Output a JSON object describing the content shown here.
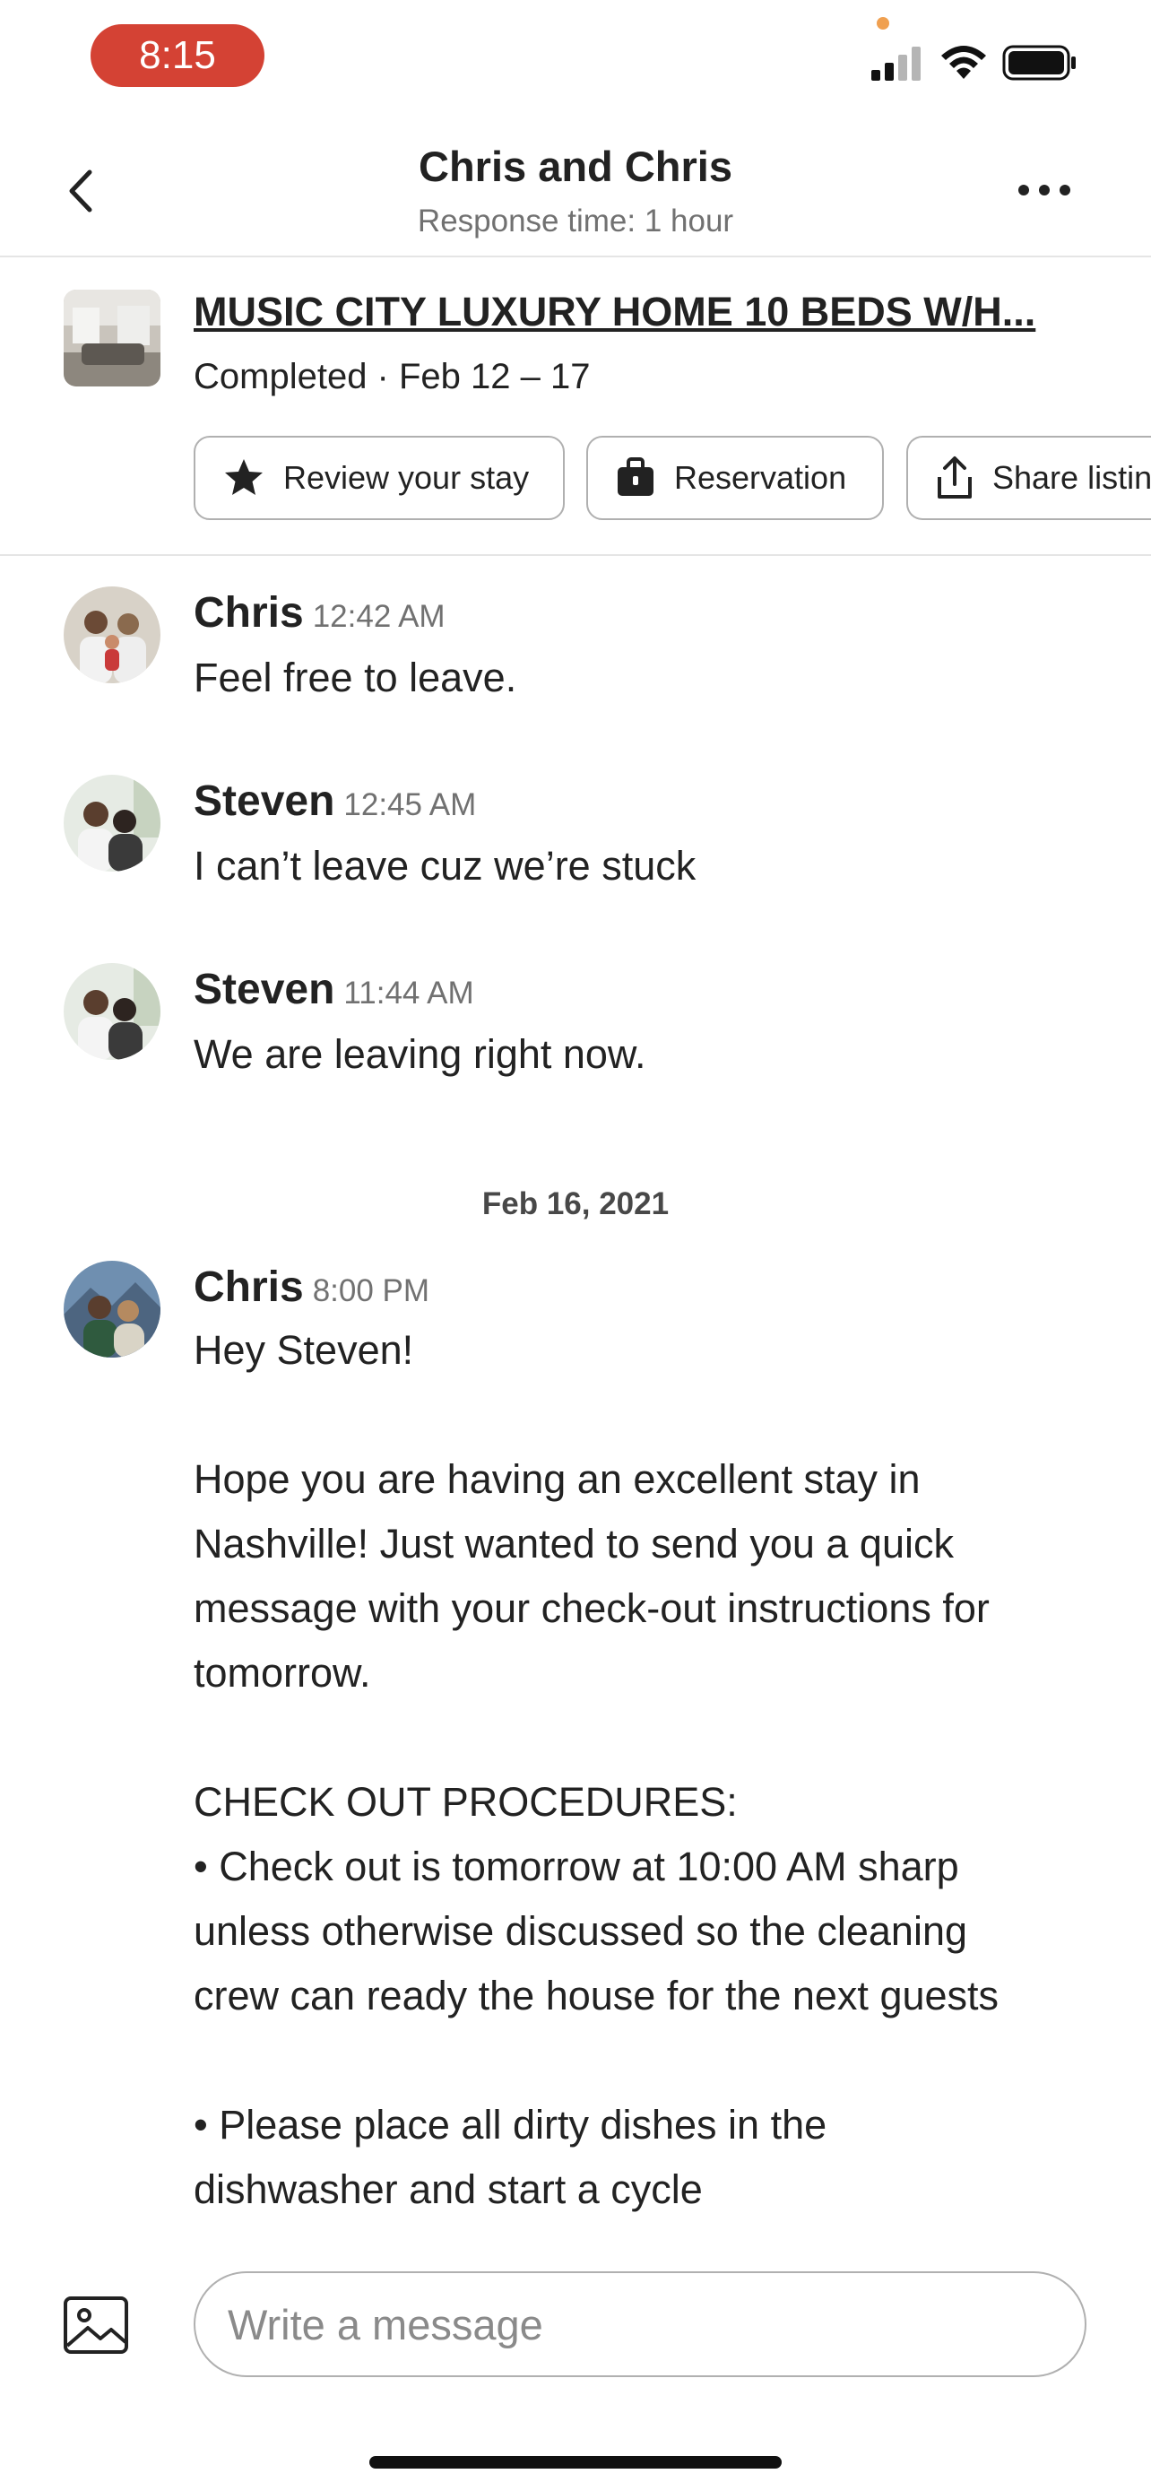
{
  "status_bar": {
    "time": "8:15"
  },
  "header": {
    "title": "Chris and Chris",
    "subtitle": "Response time: 1 hour"
  },
  "listing": {
    "title": "MUSIC CITY LUXURY HOME 10 BEDS W/H...",
    "status": "Completed · Feb 12 – 17",
    "actions": [
      {
        "label": "Review your stay",
        "icon": "star-icon"
      },
      {
        "label": "Reservation",
        "icon": "briefcase-icon"
      },
      {
        "label": "Share listin",
        "icon": "share-icon"
      }
    ]
  },
  "messages": [
    {
      "sender": "Chris",
      "time": "12:42 AM",
      "text": "Feel free to leave."
    },
    {
      "sender": "Steven",
      "time": "12:45 AM",
      "text": "I can’t leave cuz we’re stuck"
    },
    {
      "sender": "Steven",
      "time": "11:44 AM",
      "text": "We are leaving right now."
    },
    {
      "sender": "Chris",
      "time": "8:00 PM",
      "text": "Hey Steven!\n\nHope you are having an excellent stay in\nNashville! Just wanted to send you a quick\nmessage with your check-out instructions for\ntomorrow.\n\nCHECK OUT PROCEDURES:\n• Check out is tomorrow at 10:00 AM sharp\nunless otherwise discussed so the cleaning\ncrew can ready the house for the next guests\n\n• Please place all dirty dishes in the\ndishwasher and start a cycle"
    }
  ],
  "date_separator": "Feb 16, 2021",
  "composer": {
    "placeholder": "Write a message"
  },
  "colors": {
    "accent_red": "#d44234",
    "text": "#222222",
    "muted": "#717171",
    "border": "#b0b0b0"
  }
}
